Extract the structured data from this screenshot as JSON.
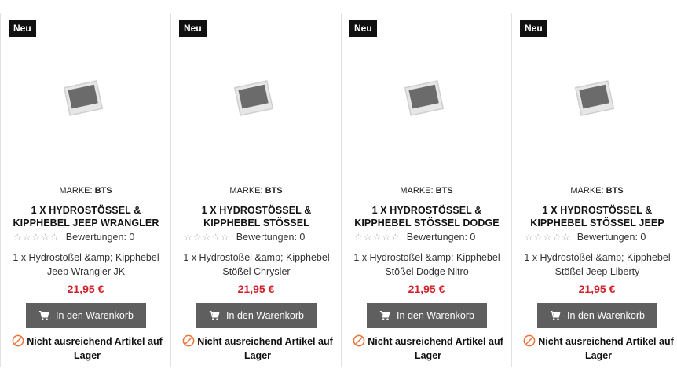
{
  "colors": {
    "badge_bg": "#111111",
    "price": "#d0212a",
    "button_bg": "#5f5f5f",
    "stock_icon": "#e8743b"
  },
  "products": [
    {
      "badge": "Neu",
      "brand_prefix": "MARKE:",
      "brand": "BTS",
      "title": "1 X HYDROSTÖSSEL & KIPPHEBEL JEEP WRANGLER",
      "stars_icon": "empty-star-icons",
      "rating_text": "Bewertungen: 0",
      "description": "1 x Hydrostößel &amp; Kipphebel Jeep Wrangler JK",
      "price": "21,95 €",
      "cart_label": "In den Warenkorb",
      "stock_text": "Nicht ausreichend Artikel auf Lager"
    },
    {
      "badge": "Neu",
      "brand_prefix": "MARKE:",
      "brand": "BTS",
      "title": "1 X HYDROSTÖSSEL & KIPPHEBEL STÖSSEL",
      "stars_icon": "empty-star-icons",
      "rating_text": "Bewertungen: 0",
      "description": "1 x Hydrostößel &amp; Kipphebel Stößel Chrysler",
      "price": "21,95 €",
      "cart_label": "In den Warenkorb",
      "stock_text": "Nicht ausreichend Artikel auf Lager"
    },
    {
      "badge": "Neu",
      "brand_prefix": "MARKE:",
      "brand": "BTS",
      "title": "1 X HYDROSTÖSSEL & KIPPHEBEL STÖSSEL DODGE",
      "stars_icon": "empty-star-icons",
      "rating_text": "Bewertungen: 0",
      "description": "1 x Hydrostößel &amp; Kipphebel Stößel Dodge Nitro",
      "price": "21,95 €",
      "cart_label": "In den Warenkorb",
      "stock_text": "Nicht ausreichend Artikel auf Lager"
    },
    {
      "badge": "Neu",
      "brand_prefix": "MARKE:",
      "brand": "BTS",
      "title": "1 X HYDROSTÖSSEL & KIPPHEBEL STÖSSEL JEEP",
      "stars_icon": "empty-star-icons",
      "rating_text": "Bewertungen: 0",
      "description": "1 x Hydrostößel &amp; Kipphebel Stößel Jeep Liberty",
      "price": "21,95 €",
      "cart_label": "In den Warenkorb",
      "stock_text": "Nicht ausreichend Artikel auf Lager"
    }
  ]
}
